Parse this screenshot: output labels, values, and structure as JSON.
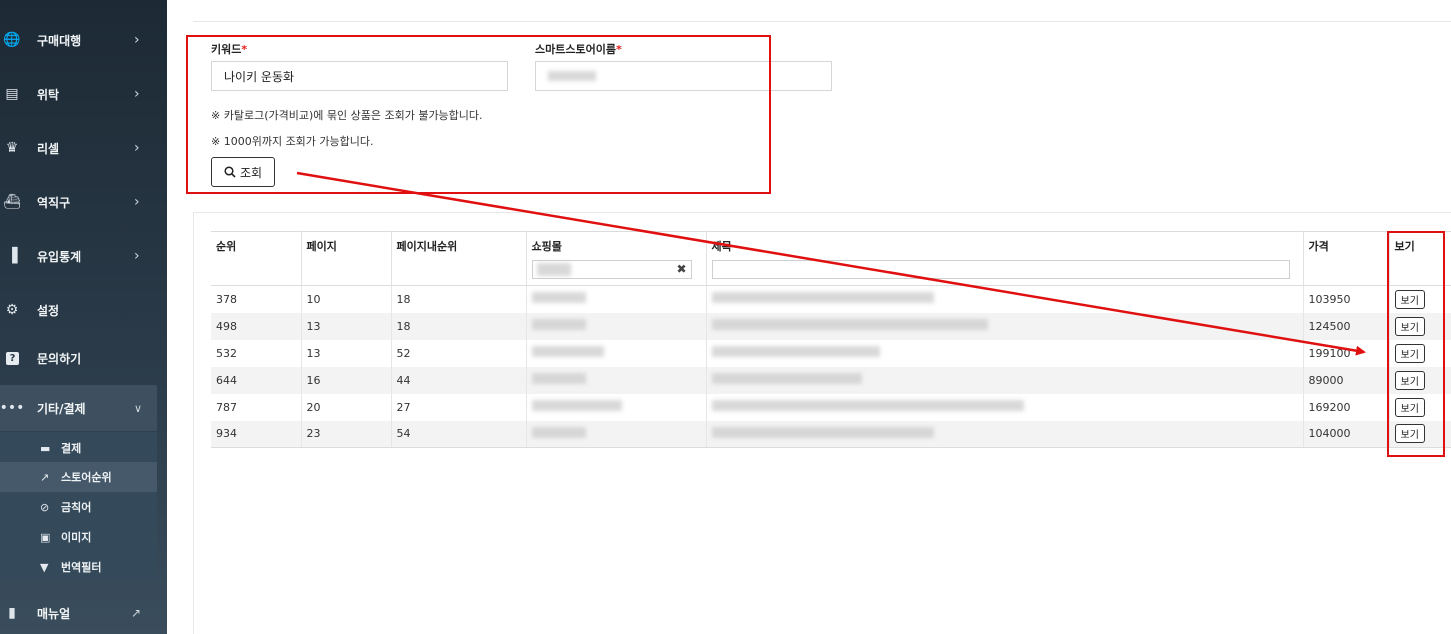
{
  "sidebar": {
    "items": [
      {
        "label": "구매대행",
        "icon": "globe-icon"
      },
      {
        "label": "위탁",
        "icon": "store-icon"
      },
      {
        "label": "리셀",
        "icon": "crown-icon"
      },
      {
        "label": "역직구",
        "icon": "ship-icon"
      },
      {
        "label": "유입통계",
        "icon": "bar-chart-icon"
      },
      {
        "label": "설정",
        "icon": "gear-icon"
      },
      {
        "label": "문의하기",
        "icon": "question-icon"
      },
      {
        "label": "기타/결제",
        "icon": "more-icon"
      }
    ],
    "submenu": [
      {
        "label": "결제",
        "icon": "card-icon"
      },
      {
        "label": "스토어순위",
        "icon": "line-chart-icon"
      },
      {
        "label": "금칙어",
        "icon": "ban-icon"
      },
      {
        "label": "이미지",
        "icon": "image-icon"
      },
      {
        "label": "번역필터",
        "icon": "filter-icon"
      }
    ],
    "manual": {
      "label": "매뉴얼",
      "icon": "book-icon"
    }
  },
  "search_form": {
    "keyword_label": "키워드",
    "keyword_value": "나이키 운동화",
    "store_label": "스마트스토어이름",
    "required_mark": "*",
    "note1": "※ 카탈로그(가격비교)에 묶인 상품은 조회가 불가능합니다.",
    "note2": "※ 1000위까지 조회가 가능합니다.",
    "search_button": "조회"
  },
  "table": {
    "headers": [
      "순위",
      "페이지",
      "페이지내순위",
      "쇼핑몰",
      "제목",
      "가격",
      "보기"
    ],
    "view_button": "보기",
    "clear_icon": "✖",
    "rows": [
      {
        "rank": "378",
        "page": "10",
        "page_rank": "18",
        "price": "103950"
      },
      {
        "rank": "498",
        "page": "13",
        "page_rank": "18",
        "price": "124500"
      },
      {
        "rank": "532",
        "page": "13",
        "page_rank": "52",
        "price": "199100"
      },
      {
        "rank": "644",
        "page": "16",
        "page_rank": "44",
        "price": "89000"
      },
      {
        "rank": "787",
        "page": "20",
        "page_rank": "27",
        "price": "169200"
      },
      {
        "rank": "934",
        "page": "23",
        "page_rank": "54",
        "price": "104000"
      }
    ]
  },
  "colors": {
    "annotation": "#e01010",
    "sidebar": "#1d2a35"
  }
}
